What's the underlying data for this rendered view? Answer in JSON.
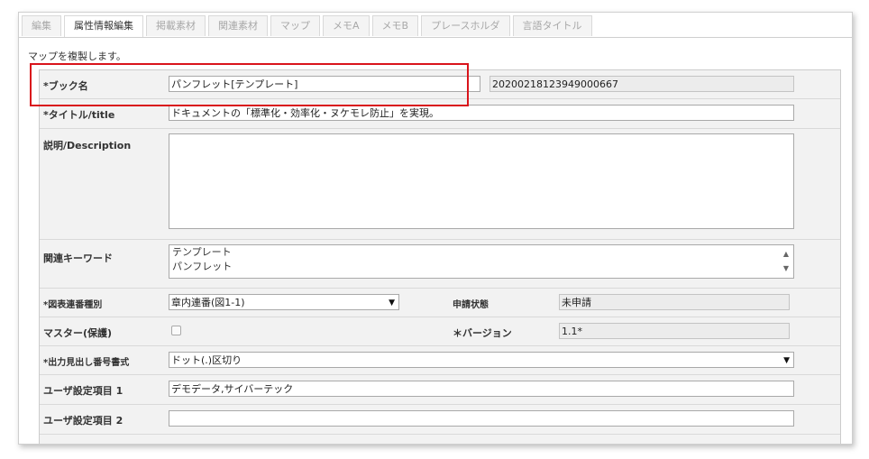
{
  "tabs": [
    {
      "label": "編集",
      "active": false
    },
    {
      "label": "属性情報編集",
      "active": true
    },
    {
      "label": "掲載素材",
      "active": false
    },
    {
      "label": "関連素材",
      "active": false
    },
    {
      "label": "マップ",
      "active": false
    },
    {
      "label": "メモA",
      "active": false
    },
    {
      "label": "メモB",
      "active": false
    },
    {
      "label": "プレースホルダ",
      "active": false
    },
    {
      "label": "言語タイトル",
      "active": false
    }
  ],
  "notice": "マップを複製します。",
  "form": {
    "book_name": {
      "label": "*ブック名",
      "value": "パンフレット[テンプレート]",
      "id_value": "20200218123949000667"
    },
    "title": {
      "label": "*タイトル/title",
      "value": "ドキュメントの「標準化・効率化・ヌケモレ防止」を実現。"
    },
    "description": {
      "label": "説明/Description",
      "value": ""
    },
    "keywords": {
      "label": "関連キーワード",
      "values": [
        "テンプレート",
        "パンフレット"
      ]
    },
    "figure_numbering": {
      "label": "*図表連番種別",
      "value": "章内連番(図1-1)"
    },
    "application_status": {
      "label": "申請状態",
      "value": "未申請"
    },
    "master": {
      "label": "マスター(保護)",
      "checked": false
    },
    "version": {
      "label": "＊バージョン",
      "value": "1.1*"
    },
    "heading_format": {
      "label": "*出力見出し番号書式",
      "value": "ドット(.)区切り"
    },
    "user_field_1": {
      "label": "ユーザ設定項目 1",
      "value": "デモデータ,サイバーテック"
    },
    "user_field_2": {
      "label": "ユーザ設定項目 2",
      "value": ""
    }
  },
  "icons": {
    "select_arrow": "▼",
    "scroll_up": "▲",
    "scroll_down": "▼"
  },
  "colors": {
    "highlight": "#d9141b",
    "panel": "#f2f2f2"
  }
}
